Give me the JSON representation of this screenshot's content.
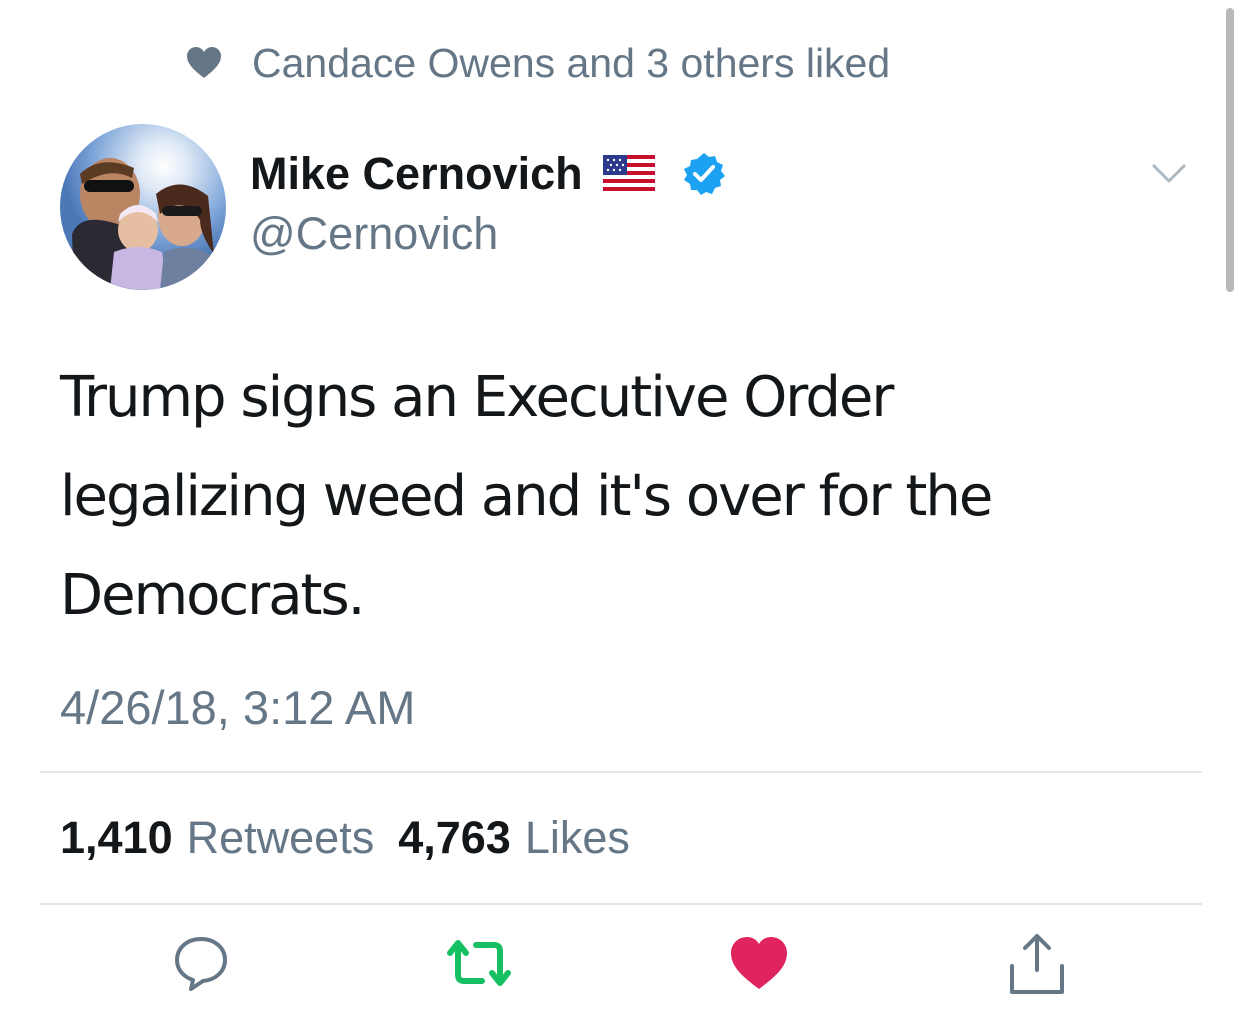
{
  "social_context": {
    "icon": "heart-icon",
    "text": "Candace Owens and 3 others liked",
    "color": "#657786"
  },
  "author": {
    "display_name": "Mike Cernovich",
    "handle": "@Cernovich",
    "flag_icon": "us-flag-icon",
    "verified_icon": "verified-badge-icon",
    "verified_color": "#1da1f2"
  },
  "menu": {
    "icon": "chevron-down-icon"
  },
  "tweet": {
    "text": "Trump signs an Executive Order legalizing weed and it's over for the Democrats.",
    "timestamp": "4/26/18, 3:12 AM"
  },
  "stats": {
    "retweet_count": "1,410",
    "retweet_label": "Retweets",
    "like_count": "4,763",
    "like_label": "Likes"
  },
  "actions": [
    {
      "name": "reply",
      "icon": "reply-icon",
      "color": "#657786"
    },
    {
      "name": "retweet",
      "icon": "retweet-icon",
      "color": "#17bf63",
      "active": true
    },
    {
      "name": "like",
      "icon": "heart-icon",
      "color": "#e0245e",
      "active": true
    },
    {
      "name": "share",
      "icon": "share-icon",
      "color": "#657786"
    }
  ]
}
